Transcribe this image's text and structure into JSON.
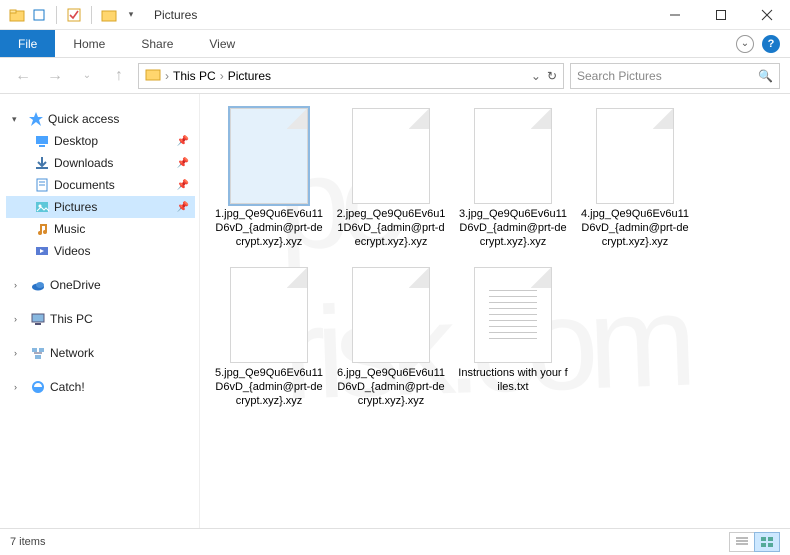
{
  "titlebar": {
    "title": "Pictures"
  },
  "ribbon": {
    "file": "File",
    "tabs": [
      "Home",
      "Share",
      "View"
    ]
  },
  "nav": {
    "back": "←",
    "forward": "→",
    "breadcrumbs": [
      "This PC",
      "Pictures"
    ],
    "search_placeholder": "Search Pictures"
  },
  "sidebar": {
    "quick_access": {
      "label": "Quick access",
      "items": [
        {
          "label": "Desktop",
          "icon": "desktop",
          "pinned": true
        },
        {
          "label": "Downloads",
          "icon": "downloads",
          "pinned": true
        },
        {
          "label": "Documents",
          "icon": "documents",
          "pinned": true
        },
        {
          "label": "Pictures",
          "icon": "pictures",
          "pinned": true,
          "selected": true
        },
        {
          "label": "Music",
          "icon": "music",
          "pinned": false
        },
        {
          "label": "Videos",
          "icon": "videos",
          "pinned": false
        }
      ]
    },
    "roots": [
      {
        "label": "OneDrive",
        "icon": "onedrive"
      },
      {
        "label": "This PC",
        "icon": "thispc"
      },
      {
        "label": "Network",
        "icon": "network"
      },
      {
        "label": "Catch!",
        "icon": "catch"
      }
    ]
  },
  "files": [
    {
      "name": "1.jpg_Qe9Qu6Ev6u11D6vD_{admin@prt-decrypt.xyz}.xyz",
      "type": "unknown",
      "selected": true
    },
    {
      "name": "2.jpeg_Qe9Qu6Ev6u11D6vD_{admin@prt-decrypt.xyz}.xyz",
      "type": "unknown"
    },
    {
      "name": "3.jpg_Qe9Qu6Ev6u11D6vD_{admin@prt-decrypt.xyz}.xyz",
      "type": "unknown"
    },
    {
      "name": "4.jpg_Qe9Qu6Ev6u11D6vD_{admin@prt-decrypt.xyz}.xyz",
      "type": "unknown"
    },
    {
      "name": "5.jpg_Qe9Qu6Ev6u11D6vD_{admin@prt-decrypt.xyz}.xyz",
      "type": "unknown"
    },
    {
      "name": "6.jpg_Qe9Qu6Ev6u11D6vD_{admin@prt-decrypt.xyz}.xyz",
      "type": "unknown"
    },
    {
      "name": "Instructions with your files.txt",
      "type": "txt"
    }
  ],
  "statusbar": {
    "count_label": "7 items"
  }
}
